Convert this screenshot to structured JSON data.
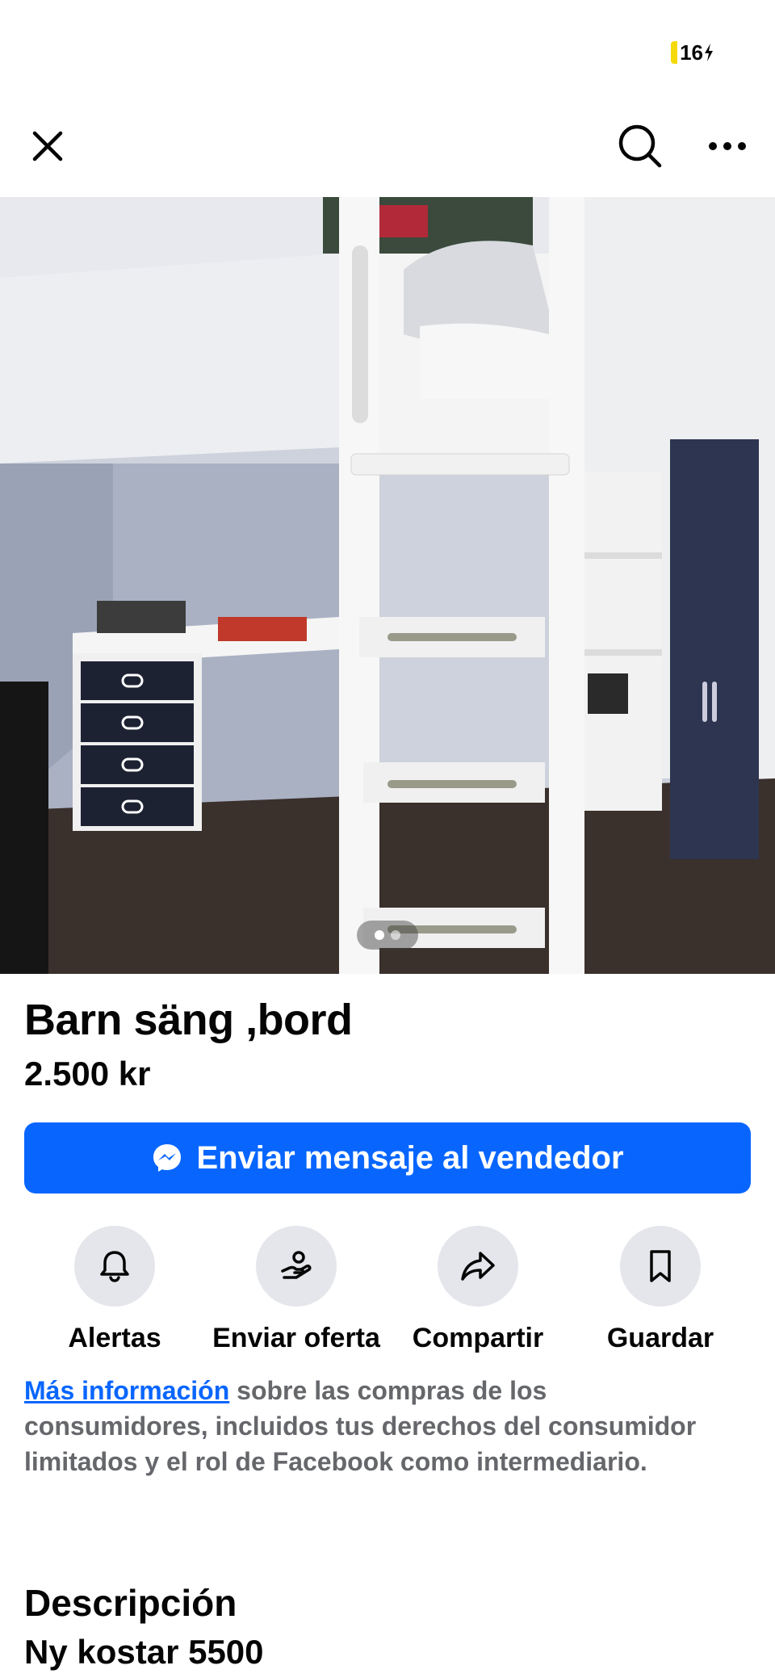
{
  "status_bar": {
    "battery": "16"
  },
  "nav": {
    "close_icon": "close-icon",
    "search_icon": "search-icon",
    "more_icon": "more-icon"
  },
  "listing": {
    "title": "Barn säng ,bord",
    "price": "2.500 kr",
    "photo_count": 2,
    "current_photo": 1
  },
  "message_button": {
    "label": "Enviar mensaje al vendedor",
    "icon": "messenger-icon"
  },
  "actions": [
    {
      "label": "Alertas",
      "icon": "bell-icon"
    },
    {
      "label": "Enviar oferta",
      "icon": "offer-icon"
    },
    {
      "label": "Compartir",
      "icon": "share-icon"
    },
    {
      "label": "Guardar",
      "icon": "bookmark-icon"
    }
  ],
  "consumer_info": {
    "link": "Más información",
    "text": " sobre las compras de los consumidores, incluidos tus derechos del consumidor limitados y el rol de Facebook como intermediario."
  },
  "description": {
    "heading": "Descripción",
    "text": "Ny kostar 5500"
  },
  "colors": {
    "accent": "#0866ff",
    "button_bg": "#e4e6eb",
    "muted_text": "#65676b"
  }
}
